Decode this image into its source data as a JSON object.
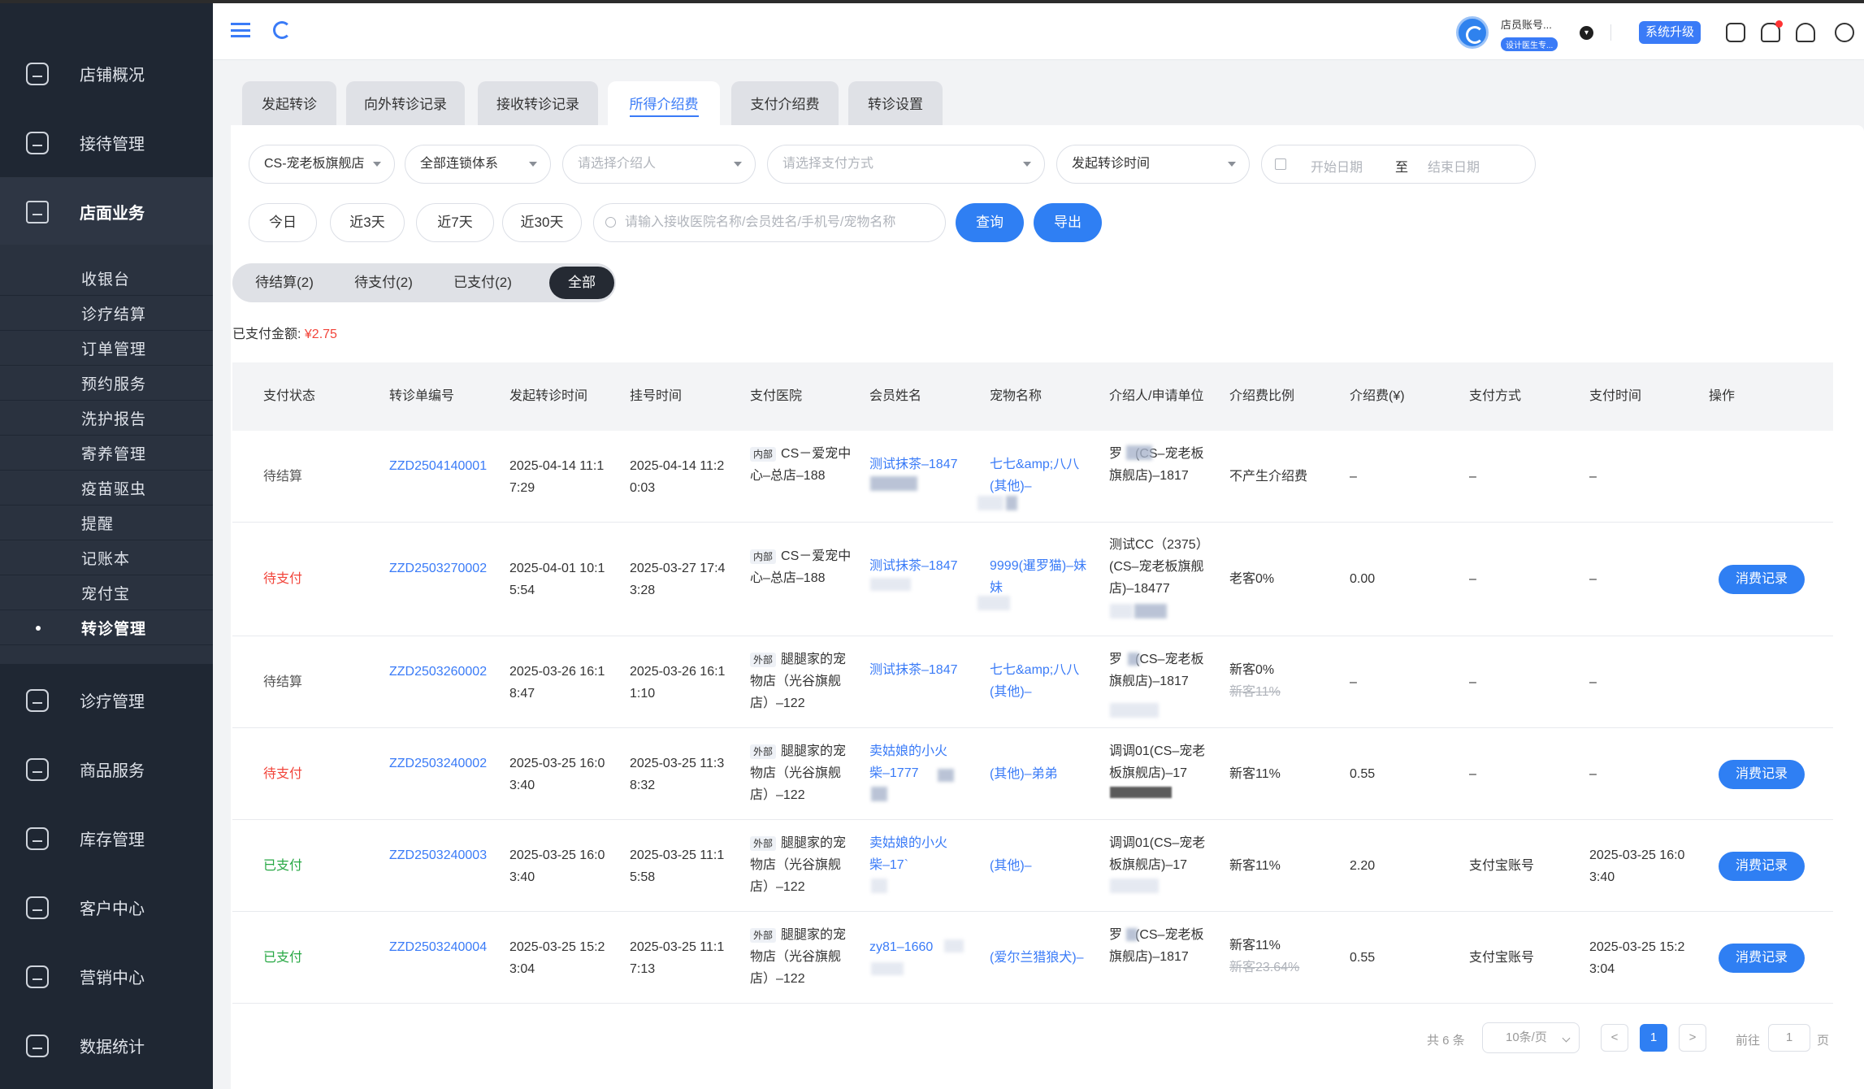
{
  "sidebar": {
    "main_items": [
      {
        "label": "店铺概况",
        "icon": "monitor-icon"
      },
      {
        "label": "接待管理",
        "icon": "clipboard-icon"
      },
      {
        "label": "店面业务",
        "icon": "home-icon"
      },
      {
        "label": "诊疗管理",
        "icon": "medical-kit-icon"
      },
      {
        "label": "商品服务",
        "icon": "shopping-bag-icon"
      },
      {
        "label": "库存管理",
        "icon": "archive-icon"
      },
      {
        "label": "客户中心",
        "icon": "user-icon"
      },
      {
        "label": "营销中心",
        "icon": "bar-chart-icon"
      },
      {
        "label": "数据统计",
        "icon": "trend-icon"
      }
    ],
    "sub_items": [
      "收银台",
      "诊疗结算",
      "订单管理",
      "预约服务",
      "洗护报告",
      "寄养管理",
      "疫苗驱虫",
      "提醒",
      "记账本",
      "宠付宝",
      "转诊管理"
    ]
  },
  "topbar": {
    "account_name": "店员账号...",
    "account_badge": "设计医生专...",
    "upgrade_label": "系统升级"
  },
  "tabs": [
    "发起转诊",
    "向外转诊记录",
    "接收转诊记录",
    "所得介绍费",
    "支付介绍费",
    "转诊设置"
  ],
  "filters": {
    "store": "CS-宠老板旗舰店",
    "chain": "全部连锁体系",
    "introducer_placeholder": "请选择介绍人",
    "pay_method_placeholder": "请选择支付方式",
    "time_type": "发起转诊时间",
    "start_placeholder": "开始日期",
    "to_label": "至",
    "end_placeholder": "结束日期",
    "quick": [
      "今日",
      "近3天",
      "近7天",
      "近30天"
    ],
    "search_placeholder": "请输入接收医院名称/会员姓名/手机号/宠物名称",
    "query_label": "查询",
    "export_label": "导出"
  },
  "segments": [
    "待结算(2)",
    "待支付(2)",
    "已支付(2)",
    "全部"
  ],
  "paid_label": "已支付金额: ",
  "paid_amount": "¥2.75",
  "table": {
    "headers": [
      "支付状态",
      "转诊单编号",
      "发起转诊时间",
      "挂号时间",
      "支付医院",
      "会员姓名",
      "宠物名称",
      "介绍人/申请单位",
      "介绍费比例",
      "介绍费(¥)",
      "支付方式",
      "支付时间",
      "操作"
    ],
    "rows": [
      {
        "status": "待结算",
        "order_no": "ZZD2504140001",
        "start_time": "2025-04-14 11:17:29",
        "reg_time": "2025-04-14 11:20:03",
        "hospital_tag": "内部",
        "hospital": "CS－爱宠中心–总店–188",
        "member": "测试抹茶–1847",
        "pet": "七七&amp;八八(其他)–",
        "introducer": "罗　(CS–宠老板旗舰店)–1817",
        "ratio": "不产生介绍费",
        "ratio_old": "",
        "fee": "–",
        "pay_method": "–",
        "pay_time": "–",
        "action": ""
      },
      {
        "status": "待支付",
        "order_no": "ZZD2503270002",
        "start_time": "2025-04-01 10:15:54",
        "reg_time": "2025-03-27 17:43:28",
        "hospital_tag": "内部",
        "hospital": "CS－爱宠中心–总店–188",
        "member": "测试抹茶–1847",
        "pet": "9999(暹罗猫)–妹妹",
        "introducer": "测试CC（2375）(CS–宠老板旗舰店)–18477",
        "ratio": "老客0%",
        "ratio_old": "",
        "fee": "0.00",
        "pay_method": "–",
        "pay_time": "–",
        "action": "消费记录"
      },
      {
        "status": "待结算",
        "order_no": "ZZD2503260002",
        "start_time": "2025-03-26 16:18:47",
        "reg_time": "2025-03-26 16:11:10",
        "hospital_tag": "外部",
        "hospital": "腿腿家的宠物店（光谷旗舰店）–122",
        "member": "测试抹茶–1847",
        "pet": "七七&amp;八八(其他)–",
        "introducer": "罗　(CS–宠老板旗舰店)–1817",
        "ratio": "新客0%",
        "ratio_old": "新客11%",
        "fee": "–",
        "pay_method": "–",
        "pay_time": "–",
        "action": ""
      },
      {
        "status": "待支付",
        "order_no": "ZZD2503240002",
        "start_time": "2025-03-25 16:03:40",
        "reg_time": "2025-03-25 11:38:32",
        "hospital_tag": "外部",
        "hospital": "腿腿家的宠物店（光谷旗舰店）–122",
        "member": "卖姑娘的小火柴–1777",
        "pet": "(其他)–弟弟",
        "introducer": "调调01(CS–宠老板旗舰店)–17",
        "ratio": "新客11%",
        "ratio_old": "",
        "fee": "0.55",
        "pay_method": "–",
        "pay_time": "–",
        "action": "消费记录"
      },
      {
        "status": "已支付",
        "order_no": "ZZD2503240003",
        "start_time": "2025-03-25 16:03:40",
        "reg_time": "2025-03-25 11:15:58",
        "hospital_tag": "外部",
        "hospital": "腿腿家的宠物店（光谷旗舰店）–122",
        "member": "卖姑娘的小火柴–17`",
        "pet": "(其他)–",
        "introducer": "调调01(CS–宠老板旗舰店)–17",
        "ratio": "新客11%",
        "ratio_old": "",
        "fee": "2.20",
        "pay_method": "支付宝账号",
        "pay_time": "2025-03-25 16:03:40",
        "action": "消费记录"
      },
      {
        "status": "已支付",
        "order_no": "ZZD2503240004",
        "start_time": "2025-03-25 15:23:04",
        "reg_time": "2025-03-25 11:17:13",
        "hospital_tag": "外部",
        "hospital": "腿腿家的宠物店（光谷旗舰店）–122",
        "member": "zy81–1660",
        "pet": "(爱尔兰猎狼犬)–",
        "introducer": "罗　(CS–宠老板旗舰店)–1817",
        "ratio": "新客11%",
        "ratio_old": "新客23.64%",
        "fee": "0.55",
        "pay_method": "支付宝账号",
        "pay_time": "2025-03-25 15:23:04",
        "action": "消费记录"
      }
    ]
  },
  "pagination": {
    "total": "共 6 条",
    "page_size": "10条/页",
    "prev": "<",
    "current": "1",
    "next": ">",
    "goto_label": "前往",
    "goto_value": "1",
    "page_unit": "页"
  },
  "colors": {
    "accent": "#2f7ff3",
    "danger": "#f2443a",
    "success": "#27a844",
    "sidebar_bg": "#1f2733"
  }
}
